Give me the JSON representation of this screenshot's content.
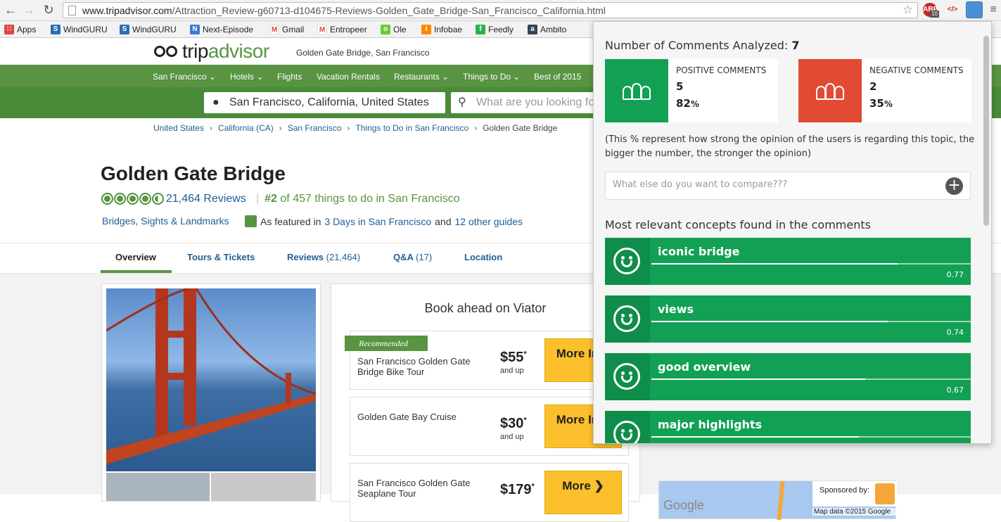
{
  "browser": {
    "url_host": "www.tripadvisor.com",
    "url_path": "/Attraction_Review-g60713-d104675-Reviews-Golden_Gate_Bridge-San_Francisco_California.html",
    "abp_badge": "10",
    "ext_code": "</>"
  },
  "bookmarks": [
    {
      "label": "Apps",
      "icon": "apps-grid-icon",
      "color": "#d44"
    },
    {
      "label": "WindGURU",
      "icon": "windguru-icon",
      "color": "#2a6db5"
    },
    {
      "label": "WindGURU",
      "icon": "windguru-icon",
      "color": "#2a6db5"
    },
    {
      "label": "Next-Episode",
      "icon": "next-episode-icon",
      "color": "#3a7bd5"
    },
    {
      "label": "Gmail",
      "icon": "gmail-icon",
      "color": "#d44"
    },
    {
      "label": "Entropeer",
      "icon": "entropeer-icon",
      "color": "#d44"
    },
    {
      "label": "Ole",
      "icon": "ole-icon",
      "color": "#6c3"
    },
    {
      "label": "Infobae",
      "icon": "infobae-icon",
      "color": "#f80"
    },
    {
      "label": "Feedly",
      "icon": "feedly-icon",
      "color": "#2bb24c"
    },
    {
      "label": "Ambito",
      "icon": "ambito-icon",
      "color": "#345"
    }
  ],
  "site": {
    "logo_trip": "trip",
    "logo_advisor": "advisor",
    "location_sub": "Golden Gate Bridge, San Francisco",
    "menu": [
      "San Francisco ⌄",
      "Hotels ⌄",
      "Flights",
      "Vacation Rentals",
      "Restaurants ⌄",
      "Things to Do ⌄",
      "Best of 2015"
    ],
    "search_location": "San Francisco, California, United States",
    "search_placeholder": "What are you looking fo",
    "breadcrumbs": [
      "United States",
      "California (CA)",
      "San Francisco",
      "Things to Do in San Francisco"
    ],
    "breadcrumb_current": "Golden Gate Bridge",
    "title": "Golden Gate Bridge",
    "rating": 4.5,
    "reviews": "21,464 Reviews",
    "rank_num": "#2",
    "rank_text": " of 457 things to do in San Francisco",
    "category": "Bridges, Sights & Landmarks",
    "featured_prefix": "As featured in",
    "featured_link1": "3 Days in San Francisco",
    "featured_and": "and",
    "featured_link2": "12 other guides",
    "tabs": [
      {
        "label": "Overview"
      },
      {
        "label": "Tours & Tickets"
      },
      {
        "label": "Reviews",
        "count": "(21,464)"
      },
      {
        "label": "Q&A",
        "count": "(17)"
      },
      {
        "label": "Location"
      }
    ],
    "viator_title": "Book ahead on Viator",
    "recommended": "Recommended",
    "tours": [
      {
        "name": "San Francisco Golden Gate Bridge Bike Tour",
        "price": "$55",
        "andup": "and up",
        "more": "More Info"
      },
      {
        "name": "Golden Gate Bay Cruise",
        "price": "$30",
        "andup": "and up",
        "more": "More Info"
      },
      {
        "name": "San Francisco Golden Gate Seaplane Tour",
        "price": "$179",
        "andup": "",
        "more": "More"
      }
    ],
    "map_sponsor": "Sponsored by:",
    "map_google": "Google",
    "map_data": "Map data ©2015 Google"
  },
  "popup": {
    "analyzed_label": "Number of Comments Analyzed:",
    "analyzed_count": "7",
    "positive": {
      "label": "POSITIVE COMMENTS",
      "count": "5",
      "pct": "82",
      "color": "#12a055"
    },
    "negative": {
      "label": "NEGATIVE COMMENTS",
      "count": "2",
      "pct": "35",
      "color": "#e24a33"
    },
    "pct_sign": "%",
    "note": "(This % represent how strong the opinion of the users is regarding this topic, the bigger the number, the stronger the opinion)",
    "compare_placeholder": "What else do you want to compare???",
    "relevant_title": "Most relevant concepts found in the comments",
    "concepts": [
      {
        "name": "iconic bridge",
        "score": "0.77",
        "value": 0.77
      },
      {
        "name": "views",
        "score": "0.74",
        "value": 0.74
      },
      {
        "name": "good overview",
        "score": "0.67",
        "value": 0.67
      },
      {
        "name": "major highlights",
        "score": "",
        "value": 0.65
      }
    ]
  }
}
